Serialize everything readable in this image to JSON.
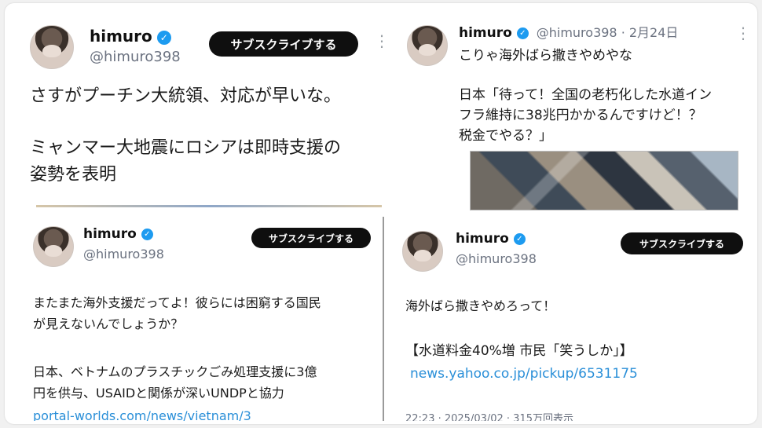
{
  "tweet_main": {
    "name": "himuro",
    "handle": "@himuro398",
    "subscribe_label": "サブスクライブする",
    "line1": "さすがプーチン大統領、対応が早いな。",
    "line2": "ミャンマー大地震にロシアは即時支援の\n姿勢を表明"
  },
  "tweet_right_top": {
    "name": "himuro",
    "handle_date": "@himuro398 · 2月24日",
    "line1": "こりゃ海外ばら撒きやめやな",
    "line2": "日本「待って！全国の老朽化した水道イン\nフラ維持に38兆円かかるんですけど！？\n税金でやる？」"
  },
  "tweet_bottom_left": {
    "name": "himuro",
    "handle": "@himuro398",
    "subscribe_label": "サブスクライブする",
    "line1": "またまた海外支援だってよ！彼らには困窮する国民\nが見えないんでしょうか？",
    "line2": "日本、ベトナムのプラスチックごみ処理支援に3億\n円を供与、USAIDと関係が深いUNDPと協力",
    "link": "portal-worlds.com/news/vietnam/3"
  },
  "tweet_bottom_right": {
    "name": "himuro",
    "handle": "@himuro398",
    "subscribe_label": "サブスクライブする",
    "line1": "海外ばら撒きやめろって！",
    "line2": "【水道料金40%増 市民「笑うしか」】",
    "link": "news.yahoo.co.jp/pickup/6531175",
    "meta": "22:23 · 2025/03/02 · 315万回表示"
  }
}
